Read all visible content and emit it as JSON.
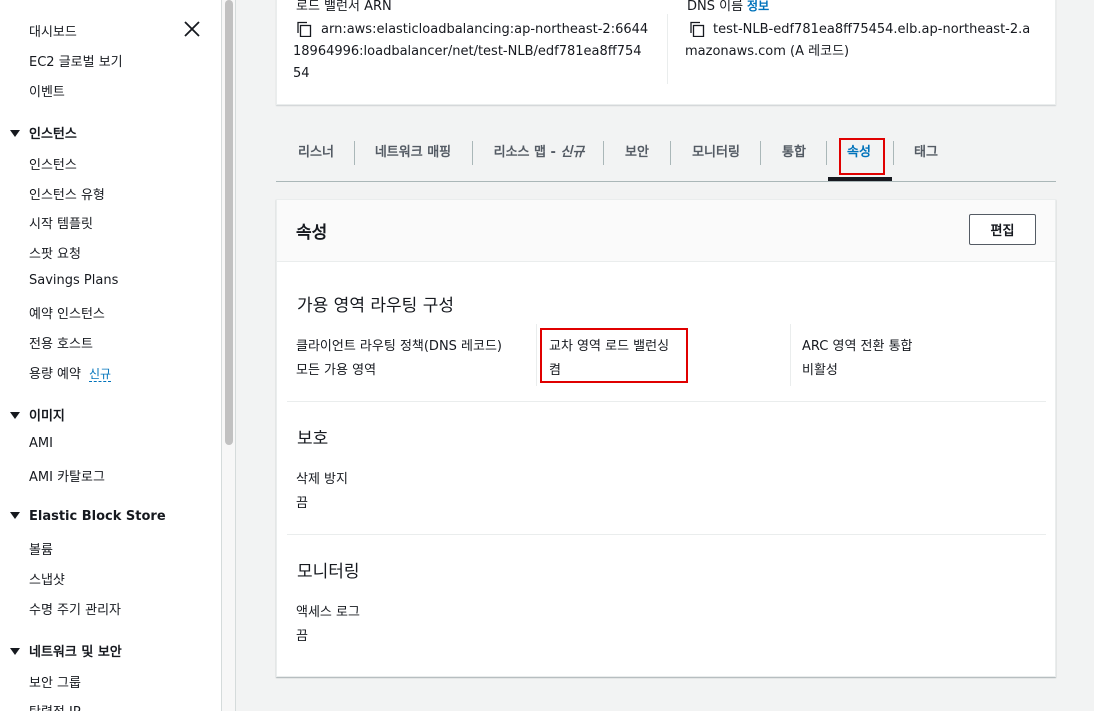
{
  "sidebar": {
    "items_top": [
      "대시보드",
      "EC2 글로벌 보기",
      "이벤트"
    ],
    "instances": {
      "title": "인스턴스",
      "items": [
        "인스턴스",
        "인스턴스 유형",
        "시작 템플릿",
        "스팟 요청",
        "Savings Plans",
        "예약 인스턴스",
        "전용 호스트",
        "용량 예약"
      ],
      "new_badge": "신규"
    },
    "images": {
      "title": "이미지",
      "items": [
        "AMI",
        "AMI 카탈로그"
      ]
    },
    "ebs": {
      "title": "Elastic Block Store",
      "items": [
        "볼륨",
        "스냅샷",
        "수명 주기 관리자"
      ]
    },
    "network": {
      "title": "네트워크 및 보안",
      "items": [
        "보안 그룹",
        "탄력적 IP"
      ]
    }
  },
  "details": {
    "arn_label": "로드 밸런서 ARN",
    "arn_lines": [
      "arn:aws:elasticloadbalancing:ap-northeast-2:6644",
      "18964996:loadbalancer/net/test-NLB/edf781ea8ff754",
      "54"
    ],
    "dns_label": "DNS 이름",
    "dns_info": "정보",
    "dns_lines": [
      "test-NLB-edf781ea8ff75454.elb.ap-northeast-2.a",
      "mazonaws.com (A 레코드)"
    ]
  },
  "tabs": {
    "listener": "리스너",
    "network_mapping": "네트워크 매핑",
    "resource_map": "리소스 맵 - ",
    "resource_map_new": "신규",
    "security": "보안",
    "monitoring": "모니터링",
    "integration": "통합",
    "attributes": "속성",
    "tags": "태그"
  },
  "attributes": {
    "title": "속성",
    "edit_label": "편집",
    "az_routing": {
      "title": "가용 영역 라우팅 구성",
      "client_policy_label": "클라이언트 라우팅 정책(DNS 레코드)",
      "client_policy_value": "모든 가용 영역",
      "cross_zone_label": "교차 영역 로드 밸런싱",
      "cross_zone_value": "켬",
      "arc_label": "ARC 영역 전환 통합",
      "arc_value": "비활성"
    },
    "protection": {
      "title": "보호",
      "delete_protection_label": "삭제 방지",
      "delete_protection_value": "끔"
    },
    "monitoring": {
      "title": "모니터링",
      "access_log_label": "액세스 로그",
      "access_log_value": "끔"
    }
  },
  "colors": {
    "accent": "#0073bb",
    "highlight": "#e00000"
  }
}
